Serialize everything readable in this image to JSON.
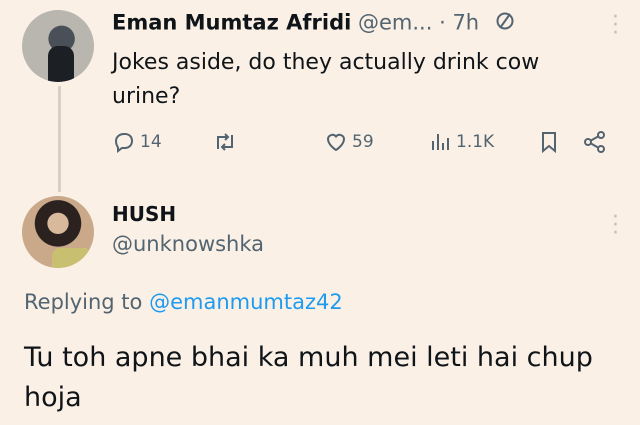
{
  "tweet": {
    "author_name": "Eman Mumtaz Afridi",
    "author_handle": "@em...",
    "time": "· 7h",
    "text": "Jokes aside, do they actually drink cow urine?",
    "stats": {
      "replies": "14",
      "likes": "59",
      "views": "1.1K"
    }
  },
  "reply": {
    "author_name": "HUSH",
    "author_handle": "@unknowshka",
    "replying_label": "Replying to ",
    "replying_to": "@emanmumtaz42",
    "text": "Tu toh apne bhai ka muh mei leti hai chup hoja"
  },
  "icons": [
    "verified-icon",
    "more-icon",
    "reply-icon",
    "retweet-icon",
    "like-icon",
    "views-icon",
    "bookmark-icon",
    "share-icon"
  ],
  "colors": {
    "background": "#fbf0e6",
    "muted": "#536471",
    "link": "#1d9bf0"
  }
}
